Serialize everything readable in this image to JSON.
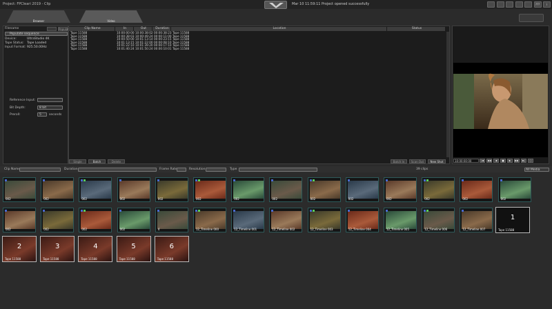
{
  "app": {
    "title": "Project: FPCleari 2019 - Clip",
    "status_message": "Mar 10 11:59:11 Project opened successfully"
  },
  "toolbar": {
    "icons": [
      "list-icon",
      "grid-icon",
      "gear-icon",
      "user-icon",
      "monitor-icon",
      "help-icon",
      "info-icon"
    ],
    "labels": [
      "",
      "",
      "",
      "",
      "",
      "???",
      "i"
    ]
  },
  "tabs": [
    {
      "label": "Browser"
    },
    {
      "label": "Video"
    }
  ],
  "left_panel": {
    "filename_label": "Filename",
    "btn1": "",
    "btn2": "Populate",
    "populate_label": "Populate sequence",
    "fields": [
      {
        "label": "Device:",
        "value": "UltraStudio 4K"
      },
      {
        "label": "Tape Status:",
        "value": "Tape Loaded"
      },
      {
        "label": "Input Format:",
        "value": "925.50.00Hz"
      }
    ],
    "reference_label": "Reference Input:",
    "bitdepth_label": "Bit Depth:",
    "bitdepth_value": "8 bit",
    "preroll_label": "Preroll:",
    "preroll_value": "5",
    "preroll_unit": "seconds"
  },
  "clip_table": {
    "headers": [
      "Clip Name",
      "In",
      "Out",
      "Duration",
      "Location",
      "Status"
    ],
    "rows": [
      [
        "Tape 11588",
        "10:00:00:00",
        "10:00:38:02",
        "00:00:38:23",
        "Tape 11588"
      ],
      [
        "Tape 11588",
        "10:00:38:03",
        "10:00:49:24",
        "00:00:11:00",
        "Tape 11588"
      ],
      [
        "Tape 11588",
        "10:00:50:00",
        "10:01:13:14",
        "00:00:23:15",
        "Tape 11588"
      ],
      [
        "Tape 11588",
        "10:01:13:15",
        "10:01:22:00",
        "00:00:08:10",
        "Tape 11588"
      ],
      [
        "Tape 11588",
        "10:01:22:10",
        "10:01:39:20",
        "00:00:17:10",
        "Tape 11588"
      ],
      [
        "Tape 11588",
        "10:01:40:24",
        "10:01:50:24",
        "00:00:10:01",
        "Tape 11588"
      ]
    ],
    "buttons": [
      "Single",
      "Batch",
      "Delete",
      "Batch In",
      "Scan Out",
      "New Shot"
    ]
  },
  "player": {
    "timecode": "10:00:00:00",
    "buttons": [
      "|◀",
      "◀◀",
      "◀",
      "■",
      "▶",
      "▶▶",
      "▶|",
      "○"
    ]
  },
  "filter_bar": {
    "clip_name": "Clip Name",
    "duration": "Duration",
    "frame_rate": "Frame Rate",
    "resolution": "Resolution",
    "type": "Type",
    "count": "39 clips",
    "media_select": "All Media"
  },
  "row1": [
    "002",
    "002",
    "002",
    "002",
    "002",
    "002",
    "002",
    "002",
    "002",
    "002",
    "002",
    "002",
    "002",
    "002"
  ],
  "row2": [
    "002",
    "002",
    "002",
    "002",
    "4",
    "12_Timeline 000",
    "12_Timeline 001",
    "12_Timeline 002",
    "12_Timeline 003",
    "12_Timeline 004",
    "12_Timeline 005",
    "12_Timeline 006",
    "12_Timeline 007"
  ],
  "row2_selected": {
    "num": "1",
    "tape": "Tape 11588"
  },
  "row3": [
    {
      "num": "2",
      "tape": "Tape 11588"
    },
    {
      "num": "3",
      "tape": "Tape 11588"
    },
    {
      "num": "4",
      "tape": "Tape 11588"
    },
    {
      "num": "5",
      "tape": "Tape 11588"
    },
    {
      "num": "6",
      "tape": "Tape 11588"
    }
  ]
}
